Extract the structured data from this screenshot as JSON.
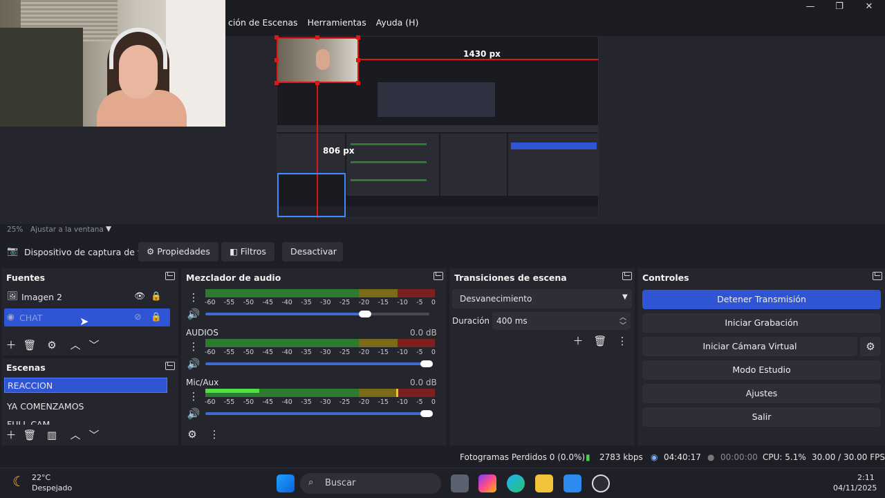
{
  "menu": {
    "items": [
      "ción de Escenas",
      "Herramientas",
      "Ayuda (H)"
    ]
  },
  "window_controls": {
    "minimize": "—",
    "maximize": "❐",
    "close": "✕"
  },
  "preview": {
    "width_label": "1430 px",
    "height_label": "806 px",
    "zoom": "25%",
    "fit": "Ajustar a la ventana"
  },
  "source_toolbar": {
    "device": "Dispositivo de captura de v",
    "properties": "Propiedades",
    "filters": "Filtros",
    "deactivate": "Desactivar"
  },
  "sources": {
    "title": "Fuentes",
    "items": [
      {
        "label": "Imagen 2",
        "visible": true,
        "locked": false
      },
      {
        "label": "CHAT",
        "visible": false,
        "locked": false
      }
    ]
  },
  "scenes": {
    "title": "Escenas",
    "items": [
      "REACCION",
      "YA COMENZAMOS",
      "FULL CAM"
    ],
    "selected": "REACCION"
  },
  "mixer": {
    "title": "Mezclador de audio",
    "channels": [
      {
        "name": "",
        "db": "",
        "volume": 0.74
      },
      {
        "name": "AUDIOS",
        "db": "0.0 dB",
        "volume": 1.0
      },
      {
        "name": "Mic/Aux",
        "db": "0.0 dB",
        "volume": 1.0
      }
    ],
    "scale": [
      "-60",
      "-55",
      "-50",
      "-45",
      "-40",
      "-35",
      "-30",
      "-25",
      "-20",
      "-15",
      "-10",
      "-5",
      "0"
    ]
  },
  "transitions": {
    "title": "Transiciones de escena",
    "selected": "Desvanecimiento",
    "duration_label": "Duración",
    "duration_value": "400 ms"
  },
  "controls": {
    "title": "Controles",
    "buttons": [
      "Detener Transmisión",
      "Iniciar Grabación",
      "Iniciar Cámara Virtual",
      "Modo Estudio",
      "Ajustes",
      "Salir"
    ]
  },
  "status": {
    "dropped": "Fotogramas Perdidos 0 (0.0%)",
    "bitrate": "2783 kbps",
    "stream_time": "04:40:17",
    "rec_time": "00:00:00",
    "cpu": "CPU: 5.1%",
    "fps": "30.00 / 30.00 FPS"
  },
  "taskbar": {
    "weather_temp": "22°C",
    "weather_desc": "Despejado",
    "search_placeholder": "Buscar",
    "time": "2:11",
    "date": "04/11/2025"
  },
  "colors": {
    "accent": "#2f55d4",
    "selection_red": "#e01616",
    "selection_blue": "#3d8bff"
  }
}
